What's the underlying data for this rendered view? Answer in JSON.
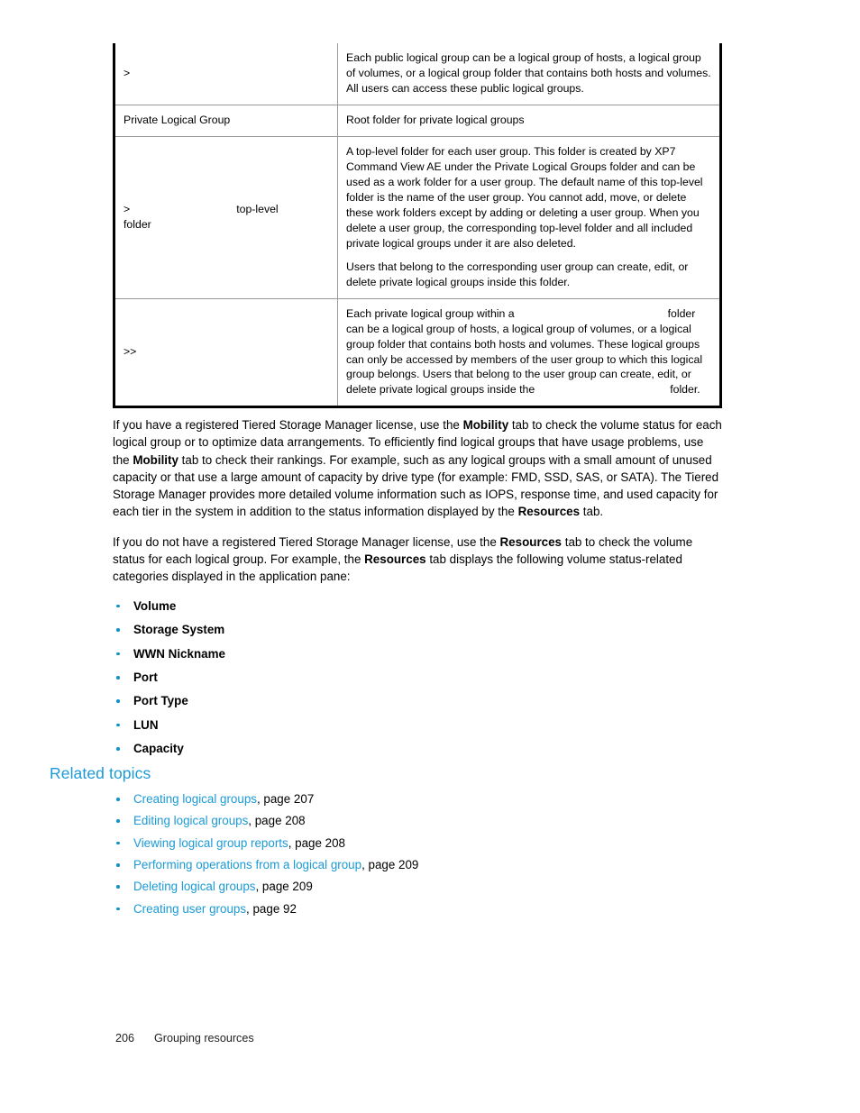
{
  "page": {
    "number": "206",
    "section_title": "Grouping resources"
  },
  "table": {
    "rows": [
      {
        "term": ">",
        "description": [
          "Each public logical group can be a logical group of hosts, a logical group of volumes, or a logical group folder that contains both hosts and volumes. All users can access these public logical groups."
        ]
      },
      {
        "term": "Private Logical Group",
        "description": [
          "Root folder for private logical groups"
        ]
      },
      {
        "term_prefix": ">",
        "term_mid": "top-level",
        "term_suffix": "folder",
        "description": [
          "A top-level folder for each user group. This folder is created by XP7 Command View AE under the Private Logical Groups folder and can be used as a work folder for a user group. The default name of this top-level folder is the name of the user group. You cannot add, move, or delete these work folders except by adding or deleting a user group. When you delete a user group, the corresponding top-level folder and all included private logical groups under it are also deleted.",
          "Users that belong to the corresponding user group can create, edit, or delete private logical groups inside this folder."
        ]
      },
      {
        "term": ">>",
        "description_parts": {
          "a": "Each private logical group within a",
          "b": "folder can be a logical group of hosts, a logical group of volumes, or a logical group folder that contains both hosts and volumes. These logical groups can only be accessed by members of the user group to which this logical group belongs. Users that belong to the user group can create, edit, or delete private logical groups inside the",
          "c": "folder."
        }
      }
    ]
  },
  "body": {
    "paragraph_1": {
      "t1": "If you have a registered Tiered Storage Manager license, use the ",
      "b1": "Mobility",
      "t2": " tab to check the volume status for each logical group or to optimize data arrangements. To efficiently find logical groups that have usage problems, use the ",
      "b2": "Mobility",
      "t3": " tab to check their rankings. For example, such as any logical groups with a small amount of unused capacity or that use a large amount of capacity by drive type (for example: FMD, SSD, SAS, or SATA). The Tiered Storage Manager provides more detailed volume information such as IOPS, response time, and used capacity for each tier in the system in addition to the status information displayed by the ",
      "b3": "Resources",
      "t4": " tab."
    },
    "paragraph_2": {
      "t1": "If you do not have a registered Tiered Storage Manager license, use the ",
      "b1": "Resources",
      "t2": " tab to check the volume status for each logical group. For example, the ",
      "b2": "Resources",
      "t3": " tab displays the following volume status-related categories displayed in the application pane:"
    },
    "categories": [
      "Volume",
      "Storage System",
      "WWN Nickname",
      "Port",
      "Port Type",
      "LUN",
      "Capacity"
    ]
  },
  "related_topics": {
    "heading": "Related topics",
    "items": [
      {
        "link": "Creating logical groups",
        "page": ", page 207"
      },
      {
        "link": "Editing logical groups",
        "page": ", page 208"
      },
      {
        "link": "Viewing logical group reports",
        "page": ", page 208"
      },
      {
        "link": "Performing operations from a logical group",
        "page": ", page 209"
      },
      {
        "link": "Deleting logical groups",
        "page": ", page 209"
      },
      {
        "link": "Creating user groups",
        "page": ", page 92"
      }
    ]
  },
  "colors": {
    "link_blue": "#1b9ad6",
    "bullet_blue": "#0d93d2",
    "table_outer_border": "#000000",
    "table_inner_border": "#9a9a9a"
  }
}
